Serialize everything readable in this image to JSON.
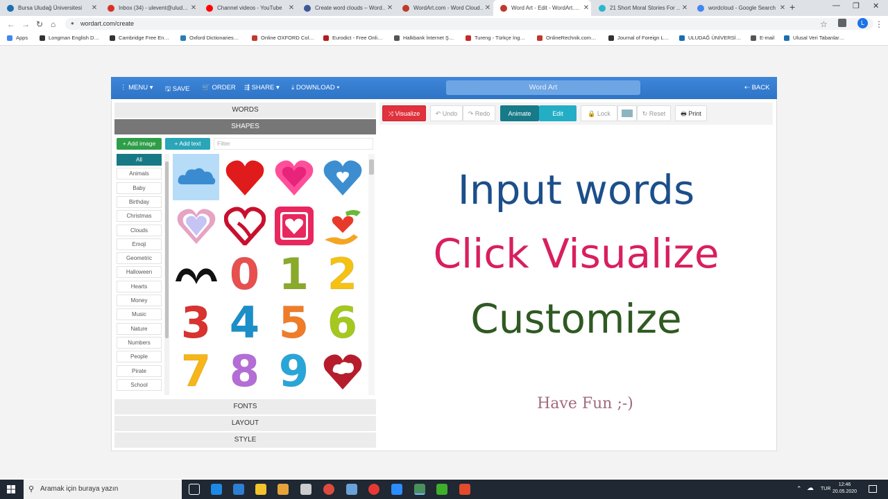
{
  "browser": {
    "tabs": [
      {
        "title": "Bursa Uludağ Üniversitesi",
        "color": "#1a6fb4"
      },
      {
        "title": "Inbox (34) - ulevent@ulud…",
        "color": "#d93025"
      },
      {
        "title": "Channel videos - YouTube",
        "color": "#ff0000"
      },
      {
        "title": "Create word clouds – Word…",
        "color": "#3b5998"
      },
      {
        "title": "WordArt.com - Word Cloud…",
        "color": "#c0392b"
      },
      {
        "title": "Word Art - Edit - WordArt.…",
        "color": "#c0392b"
      },
      {
        "title": "21 Short Moral Stories For …",
        "color": "#2ab7ca"
      },
      {
        "title": "wordcloud - Google Search",
        "color": "#4285f4"
      }
    ],
    "close_glyph": "✕",
    "new_tab_glyph": "+",
    "url": "wordart.com/create",
    "profile_initial": "L",
    "bookmarks": [
      {
        "label": "Apps"
      },
      {
        "label": "Longman English D…"
      },
      {
        "label": "Cambridge Free En…"
      },
      {
        "label": "Oxford Dictionaries…"
      },
      {
        "label": "Online OXFORD Col…"
      },
      {
        "label": "Eurodict - Free Onli…"
      },
      {
        "label": "Halkbank İnternet Ş…"
      },
      {
        "label": "Tureng - Türkçe İng…"
      },
      {
        "label": "OnlineRechnik.com…"
      },
      {
        "label": "Journal of Foreign L…"
      },
      {
        "label": "ULUDAĞ ÜNİVERSİ…"
      },
      {
        "label": "E-mail"
      },
      {
        "label": "Ulusal Veri Tabanlar…"
      }
    ]
  },
  "app": {
    "nav": {
      "menu": "⋮ MENU ▾",
      "save": "🖫 SAVE",
      "order": "🛒 ORDER",
      "share": "⇶ SHARE ▾",
      "download": "⤓ DOWNLOAD ▾",
      "back": "⇠ BACK"
    },
    "title": "Word Art",
    "sections": {
      "words": "WORDS",
      "shapes": "SHAPES",
      "fonts": "FONTS",
      "layout": "LAYOUT",
      "style": "STYLE"
    },
    "buttons": {
      "add_image": "+ Add image",
      "add_text": "+ Add text",
      "filter_placeholder": "Filter"
    },
    "categories": [
      "All",
      "Animals",
      "Baby",
      "Birthday",
      "Christmas",
      "Clouds",
      "Emoji",
      "Geometric",
      "Halloween",
      "Hearts",
      "Money",
      "Music",
      "Nature",
      "Numbers",
      "People",
      "Pirate",
      "School"
    ],
    "selected_category": "All",
    "shapes": [
      {
        "name": "cloud-shape",
        "selected": true
      },
      {
        "name": "red-heart-shape"
      },
      {
        "name": "pink-heart-shape"
      },
      {
        "name": "blue-heart-outline-shape"
      },
      {
        "name": "pastel-heart-shape"
      },
      {
        "name": "heart-arrow-shape"
      },
      {
        "name": "heart-square-shape"
      },
      {
        "name": "heart-hands-shape"
      },
      {
        "name": "hands-heart-shape"
      },
      {
        "name": "number-0-shape",
        "glyph": "0",
        "color": "#e8504f"
      },
      {
        "name": "number-1-shape",
        "glyph": "1",
        "color": "#8aaa2a"
      },
      {
        "name": "number-2-shape",
        "glyph": "2",
        "color": "#f5c213"
      },
      {
        "name": "number-3-shape",
        "glyph": "3",
        "color": "#d9322f"
      },
      {
        "name": "number-4-shape",
        "glyph": "4",
        "color": "#1a8fc9"
      },
      {
        "name": "number-5-shape",
        "glyph": "5",
        "color": "#f07c28"
      },
      {
        "name": "number-6-shape",
        "glyph": "6",
        "color": "#a5c81e"
      },
      {
        "name": "number-7-shape",
        "glyph": "7",
        "color": "#f6b519"
      },
      {
        "name": "number-8-shape",
        "glyph": "8",
        "color": "#b46dd6"
      },
      {
        "name": "number-9-shape",
        "glyph": "9",
        "color": "#29a6d9"
      },
      {
        "name": "heart-cloud-shape"
      }
    ],
    "toolbar": {
      "visualize": "⤨ Visualize",
      "undo": "↶ Undo",
      "redo": "↷ Redo",
      "animate": "Animate",
      "edit": "Edit",
      "lock": "🔒 Lock",
      "reset": "↻ Reset",
      "print": "🖶 Print"
    },
    "preview": {
      "line1": "Input words",
      "line2": "Click Visualize",
      "line3": "Customize",
      "line4": "Have Fun ;-)",
      "colors": {
        "line1": "#1c4f8a",
        "line2": "#d81f5f",
        "line3": "#2f5a22",
        "line4": "#a16b7c"
      }
    }
  },
  "taskbar": {
    "search": "Aramak için buraya yazın",
    "lang": "TUR",
    "time": "12:46",
    "date": "20.05.2020"
  }
}
